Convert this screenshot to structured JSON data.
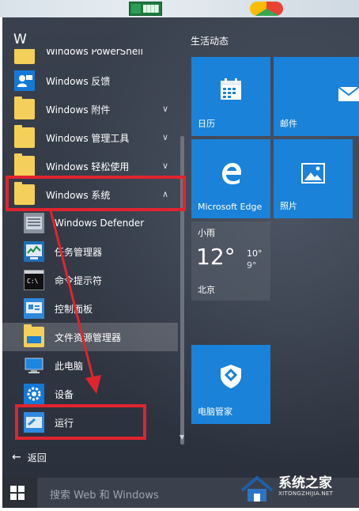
{
  "start_menu": {
    "section_letter": "W",
    "list": [
      {
        "label": "Windows PowerShell",
        "icon": "folder-icon",
        "partial": true
      },
      {
        "label": "Windows 反馈",
        "icon": "feedback-icon"
      },
      {
        "label": "Windows 附件",
        "icon": "folder-icon",
        "chevron": "∨"
      },
      {
        "label": "Windows 管理工具",
        "icon": "folder-icon",
        "chevron": "∨"
      },
      {
        "label": "Windows 轻松使用",
        "icon": "folder-icon",
        "chevron": "∨"
      },
      {
        "label": "Windows 系统",
        "icon": "folder-icon",
        "chevron": "∧"
      }
    ],
    "sub_items": [
      {
        "label": "Windows Defender",
        "icon": "defender-icon"
      },
      {
        "label": "任务管理器",
        "icon": "task-manager-icon"
      },
      {
        "label": "命令提示符",
        "icon": "cmd-icon"
      },
      {
        "label": "控制面板",
        "icon": "control-panel-icon"
      },
      {
        "label": "文件资源管理器",
        "icon": "file-explorer-icon"
      },
      {
        "label": "此电脑",
        "icon": "this-pc-icon"
      },
      {
        "label": "设备",
        "icon": "settings-gear-icon"
      },
      {
        "label": "运行",
        "icon": "run-icon"
      }
    ],
    "back_label": "返回"
  },
  "tiles": {
    "group_title": "生活动态",
    "calendar": "日历",
    "mail": "邮件",
    "edge": "Microsoft Edge",
    "photos": "照片",
    "weather": {
      "condition": "小雨",
      "temp": "12°",
      "high": "10°",
      "low": "9°",
      "city": "北京"
    },
    "pc_manager": "电脑管家"
  },
  "taskbar": {
    "search_placeholder": "搜索 Web 和 Windows"
  },
  "watermark": {
    "title": "系统之家",
    "url": "XITONGZHIJIA.NET"
  },
  "colors": {
    "tile_blue": "#1a82d9",
    "highlight_red": "#e0242f",
    "menu_bg": "#2d3340"
  }
}
